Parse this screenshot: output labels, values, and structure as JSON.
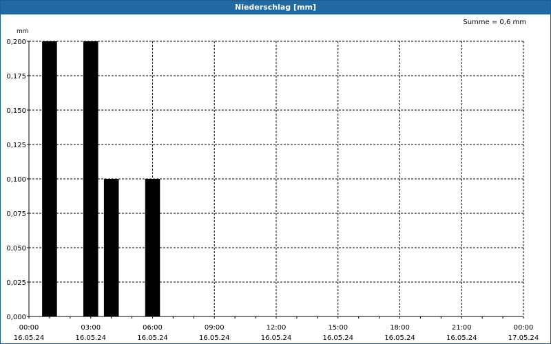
{
  "window": {
    "title": "Niederschlag [mm]"
  },
  "summary": "Summe = 0,6 mm",
  "chart_data": {
    "type": "bar",
    "title": "Niederschlag [mm]",
    "ylabel": "mm",
    "xlabel": "",
    "ylim": [
      0,
      0.2
    ],
    "y_ticks": [
      "0,000",
      "0,025",
      "0,050",
      "0,075",
      "0,100",
      "0,125",
      "0,150",
      "0,175",
      "0,200"
    ],
    "x_ticks": [
      {
        "time": "00:00",
        "date": "16.05.24"
      },
      {
        "time": "03:00",
        "date": "16.05.24"
      },
      {
        "time": "06:00",
        "date": "16.05.24"
      },
      {
        "time": "09:00",
        "date": "16.05.24"
      },
      {
        "time": "12:00",
        "date": "16.05.24"
      },
      {
        "time": "15:00",
        "date": "16.05.24"
      },
      {
        "time": "18:00",
        "date": "16.05.24"
      },
      {
        "time": "21:00",
        "date": "16.05.24"
      },
      {
        "time": "00:00",
        "date": "17.05.24"
      }
    ],
    "bars": [
      {
        "x": "16.05.24 01:00",
        "value": 0.2
      },
      {
        "x": "16.05.24 03:00",
        "value": 0.2
      },
      {
        "x": "16.05.24 04:00",
        "value": 0.1
      },
      {
        "x": "16.05.24 06:00",
        "value": 0.1
      }
    ],
    "grid": true,
    "bar_color": "#000000"
  }
}
